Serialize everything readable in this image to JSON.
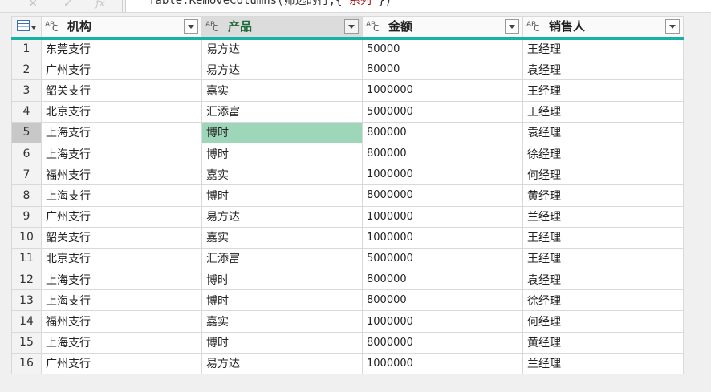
{
  "formula": {
    "prefix": "Table.RemoveColumns(筛选的行,{",
    "string": "\"系列\"",
    "suffix": "})"
  },
  "columns": [
    {
      "name": "机构",
      "type_icon": "text-type-icon"
    },
    {
      "name": "产品",
      "type_icon": "text-type-icon"
    },
    {
      "name": "金额",
      "type_icon": "text-type-icon"
    },
    {
      "name": "销售人",
      "type_icon": "text-type-icon"
    }
  ],
  "selected_column": 1,
  "selected_row": 5,
  "colors": {
    "accent": "#16b3a4",
    "active_cell": "#9dd6b8"
  },
  "rows": [
    {
      "n": "1",
      "cells": [
        "东莞支行",
        "易方达",
        "50000",
        "王经理"
      ]
    },
    {
      "n": "2",
      "cells": [
        "广州支行",
        "易方达",
        "80000",
        "袁经理"
      ]
    },
    {
      "n": "3",
      "cells": [
        "韶关支行",
        "嘉实",
        "1000000",
        "王经理"
      ]
    },
    {
      "n": "4",
      "cells": [
        "北京支行",
        "汇添富",
        "5000000",
        "王经理"
      ]
    },
    {
      "n": "5",
      "cells": [
        "上海支行",
        "博时",
        "800000",
        "袁经理"
      ]
    },
    {
      "n": "6",
      "cells": [
        "上海支行",
        "博时",
        "800000",
        "徐经理"
      ]
    },
    {
      "n": "7",
      "cells": [
        "福州支行",
        "嘉实",
        "1000000",
        "何经理"
      ]
    },
    {
      "n": "8",
      "cells": [
        "上海支行",
        "博时",
        "8000000",
        "黄经理"
      ]
    },
    {
      "n": "9",
      "cells": [
        "广州支行",
        "易方达",
        "1000000",
        "兰经理"
      ]
    },
    {
      "n": "10",
      "cells": [
        "韶关支行",
        "嘉实",
        "1000000",
        "王经理"
      ]
    },
    {
      "n": "11",
      "cells": [
        "北京支行",
        "汇添富",
        "5000000",
        "王经理"
      ]
    },
    {
      "n": "12",
      "cells": [
        "上海支行",
        "博时",
        "800000",
        "袁经理"
      ]
    },
    {
      "n": "13",
      "cells": [
        "上海支行",
        "博时",
        "800000",
        "徐经理"
      ]
    },
    {
      "n": "14",
      "cells": [
        "福州支行",
        "嘉实",
        "1000000",
        "何经理"
      ]
    },
    {
      "n": "15",
      "cells": [
        "上海支行",
        "博时",
        "8000000",
        "黄经理"
      ]
    },
    {
      "n": "16",
      "cells": [
        "广州支行",
        "易方达",
        "1000000",
        "兰经理"
      ]
    }
  ]
}
